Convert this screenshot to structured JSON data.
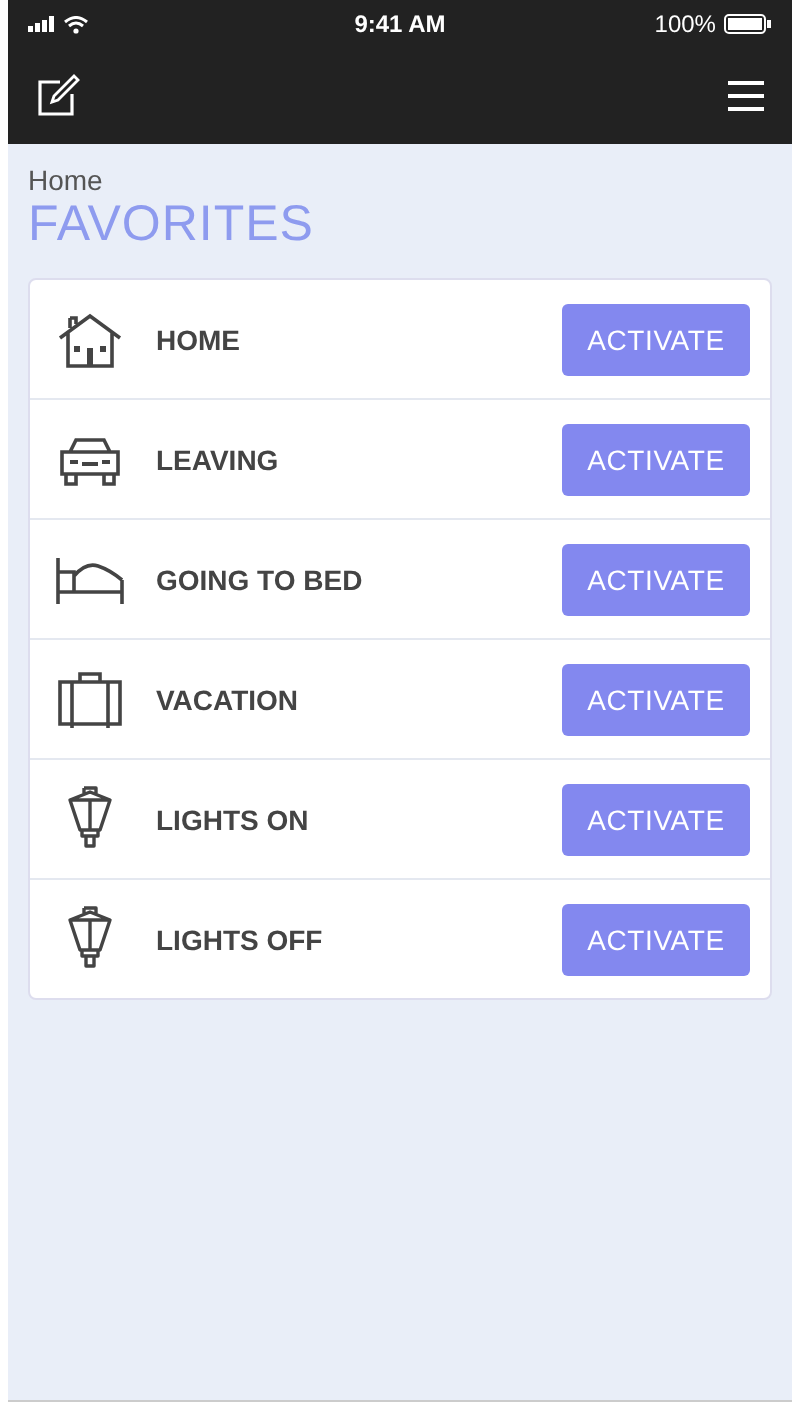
{
  "status_bar": {
    "time": "9:41 AM",
    "battery": "100%"
  },
  "breadcrumb": "Home",
  "title": "FAVORITES",
  "scenes": [
    {
      "kind": "house",
      "label": "HOME",
      "button": "ACTIVATE"
    },
    {
      "kind": "car",
      "label": "LEAVING",
      "button": "ACTIVATE"
    },
    {
      "kind": "bed",
      "label": "GOING TO BED",
      "button": "ACTIVATE"
    },
    {
      "kind": "suitcase",
      "label": "VACATION",
      "button": "ACTIVATE"
    },
    {
      "kind": "lamp",
      "label": "LIGHTS ON",
      "button": "ACTIVATE"
    },
    {
      "kind": "lamp",
      "label": "LIGHTS OFF",
      "button": "ACTIVATE"
    }
  ]
}
